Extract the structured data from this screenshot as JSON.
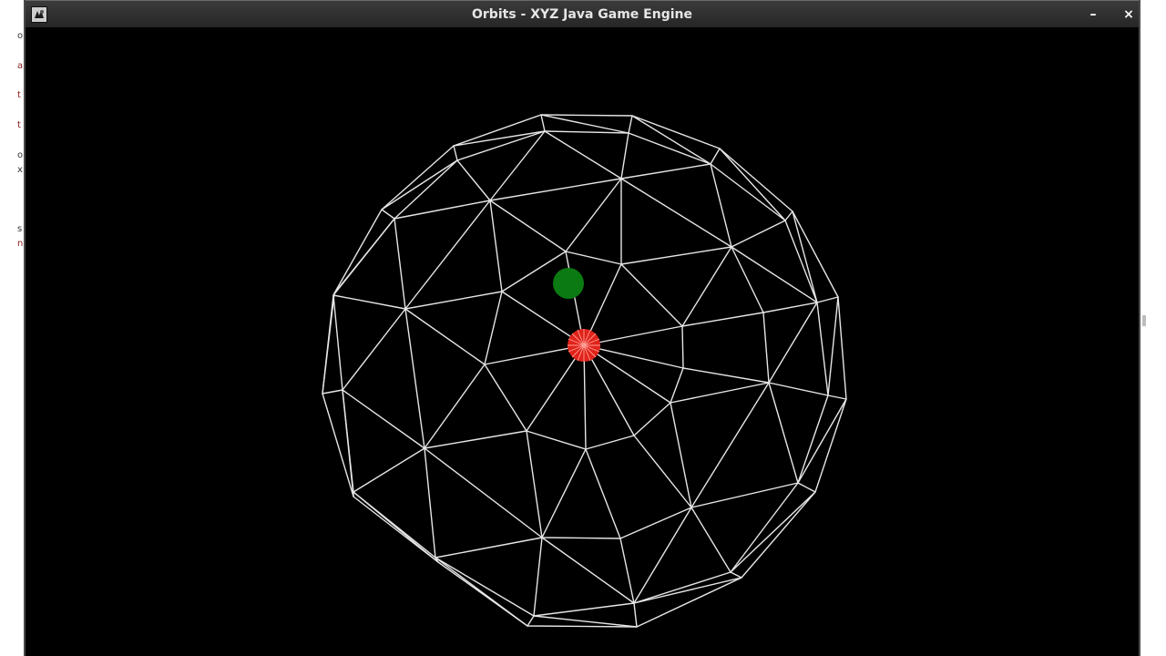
{
  "window": {
    "title": "Orbits - XYZ Java Game Engine",
    "icon": "java-app-icon",
    "controls": {
      "minimize_label": "–",
      "minimize_icon": "minimize-icon",
      "close_label": "×",
      "close_icon": "close-icon"
    }
  },
  "background_window": {
    "glyphs": [
      "o",
      "a",
      "t",
      "t",
      "o",
      "x",
      "s",
      "n"
    ]
  },
  "scene": {
    "background_color": "#000000",
    "wireframe_color": "#e6e6e6",
    "planet_color": "#0b7a12",
    "sun_color": "#e0231a",
    "sun_line_color": "#ff9c94"
  }
}
